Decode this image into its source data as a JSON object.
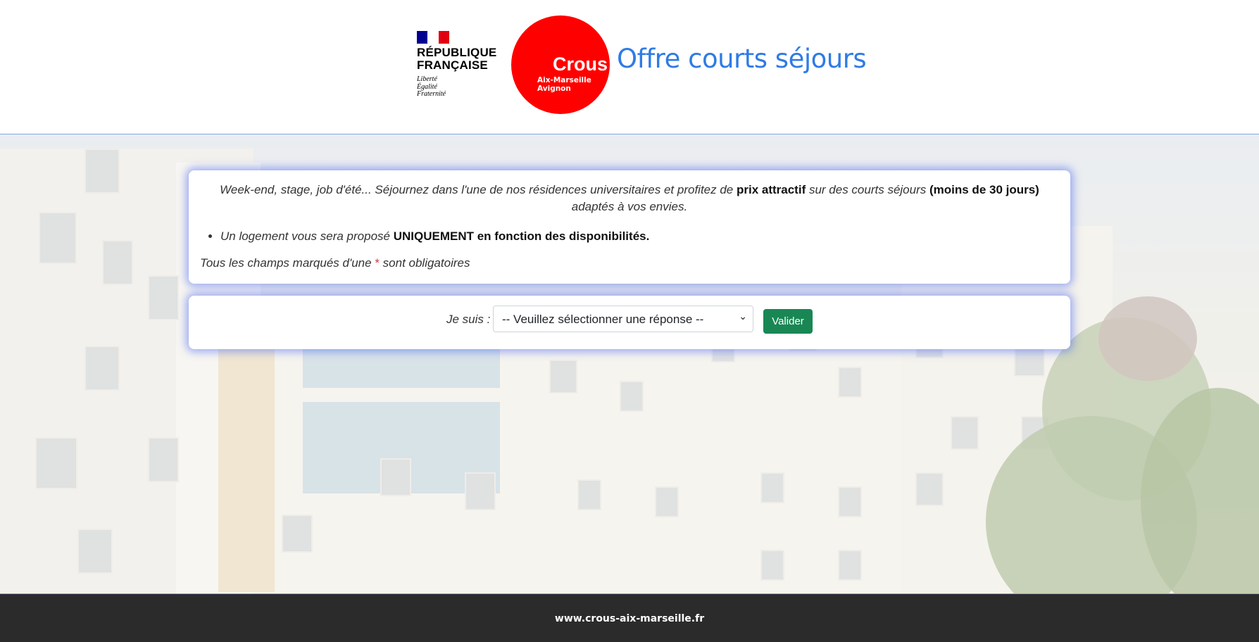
{
  "header": {
    "gov_logo": {
      "name": "RÉPUBLIQUE FRANÇAISE",
      "motto": [
        "Liberté",
        "Égalité",
        "Fraternité"
      ]
    },
    "crous_logo": {
      "word": "Crous",
      "subtitle": [
        "Aix-Marseille",
        "Avignon"
      ],
      "color": "#ff0000"
    },
    "title": "Offre courts séjours",
    "title_color": "#2f7be5"
  },
  "intro": {
    "t1": "Week-end, stage, job d'été... Séjournez dans l'une de nos résidences universitaires et profitez de ",
    "b1": "prix attractif",
    "t2": " sur des courts séjours ",
    "b2": "(moins de 30 jours)",
    "t3": " adaptés à vos envies."
  },
  "bullets": [
    {
      "t": "Un logement vous sera proposé ",
      "b": "UNIQUEMENT en fonction des disponibilités."
    }
  ],
  "required_note": {
    "pre": "Tous les champs marqués d'une ",
    "star": "*",
    "post": " sont obligatoires"
  },
  "form": {
    "label": "Je suis :",
    "select_value": "-- Veuillez sélectionner une réponse --",
    "submit_label": "Valider",
    "submit_color": "#198754"
  },
  "footer": {
    "link": "www.crous-aix-marseille.fr"
  }
}
